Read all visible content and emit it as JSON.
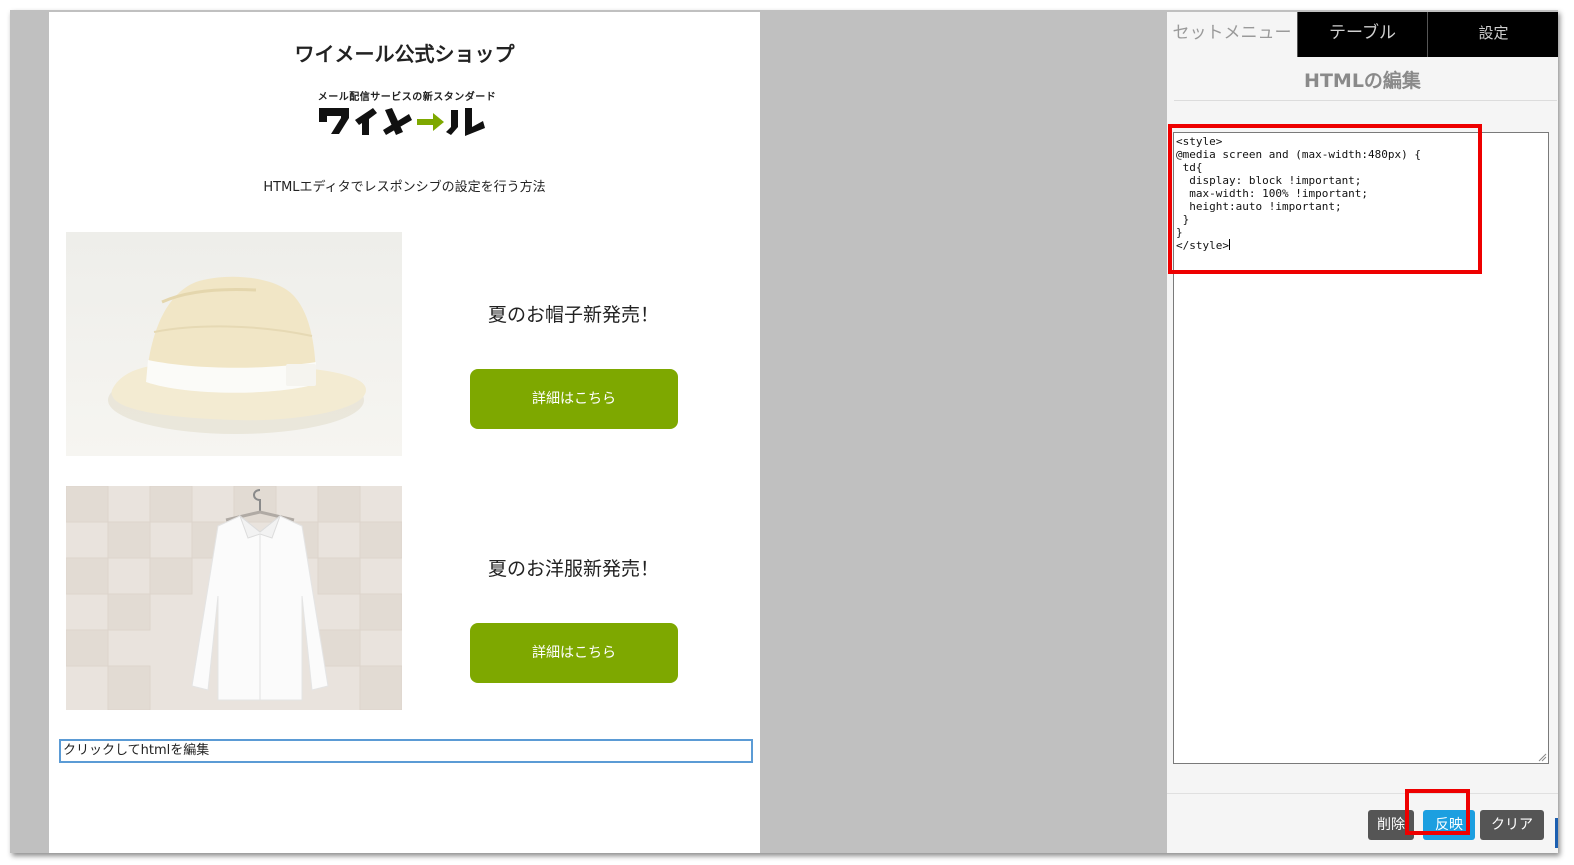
{
  "email": {
    "shop_title": "ワイメール公式ショップ",
    "logo": {
      "tagline": "メール配信サービスの新スタンダード",
      "wordmark": "ワイメール",
      "accent_color": "#7ea800"
    },
    "subtitle": "HTMLエディタでレスポンシブの設定を行う方法",
    "products": [
      {
        "title": "夏のお帽子新発売！",
        "button_label": "詳細はこちら"
      },
      {
        "title": "夏のお洋服新発売！",
        "button_label": "詳細はこちら"
      }
    ],
    "edit_placeholder": "クリックしてhtmlを編集"
  },
  "panel": {
    "tabs": [
      "セットメニュー",
      "テーブル",
      "設定"
    ],
    "title": "HTMLの編集",
    "code": "<style>\n@media screen and (max-width:480px) {\n td{\n  display: block !important;\n  max-width: 100% !important;\n  height:auto !important;\n }\n}\n</style>",
    "buttons": {
      "delete": "削除",
      "apply": "反映",
      "clear": "クリア"
    }
  },
  "colors": {
    "cta_green": "#7ea800",
    "apply_blue": "#1c9fe0",
    "highlight_red": "#ee0000"
  }
}
